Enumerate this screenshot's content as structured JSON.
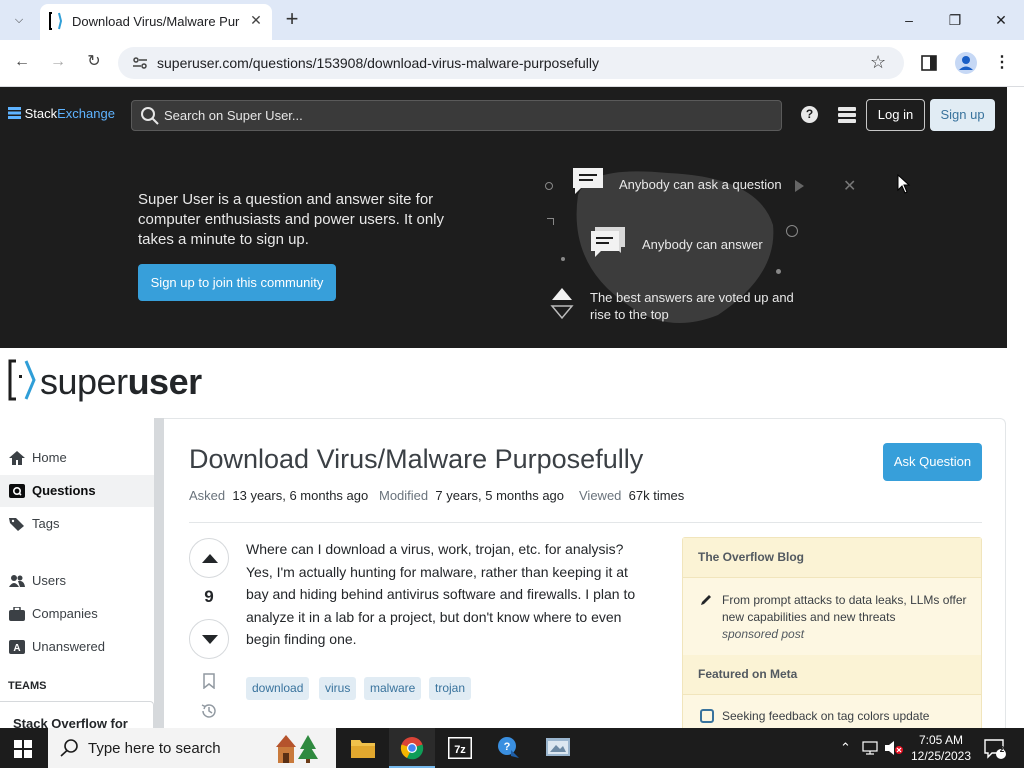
{
  "browser": {
    "tab_title": "Download Virus/Malware Purpos",
    "url": "superuser.com/questions/153908/download-virus-malware-purposefully",
    "new_tab": "+"
  },
  "topbar": {
    "logo_stack": "Stack",
    "logo_exchange": "Exchange",
    "search_placeholder": "Search on Super User...",
    "help": "?",
    "login": "Log in",
    "signup": "Sign up"
  },
  "banner": {
    "pitch": "Super User is a question and answer site for computer enthusiasts and power users. It only takes a minute to sign up.",
    "join": "Sign up to join this community",
    "feature_1": "Anybody can ask a question",
    "feature_2": "Anybody can answer",
    "feature_3": "The best answers are voted up and rise to the top"
  },
  "site": {
    "name_light": "super",
    "name_bold": "user"
  },
  "nav": {
    "items": [
      {
        "label": "Home"
      },
      {
        "label": "Questions"
      },
      {
        "label": "Tags"
      },
      {
        "label": "Users"
      },
      {
        "label": "Companies"
      },
      {
        "label": "Unanswered"
      }
    ],
    "teams_heading": "TEAMS",
    "teams_item": "Stack Overflow for"
  },
  "question": {
    "title": "Download Virus/Malware Purposefully",
    "ask_button": "Ask Question",
    "asked_label": "Asked",
    "asked_value": "13 years, 6 months ago",
    "modified_label": "Modified",
    "modified_value": "7 years, 5 months ago",
    "viewed_label": "Viewed",
    "viewed_value": "67k times",
    "score": "9",
    "body": "Where can I download a virus, work, trojan, etc. for analysis? Yes, I'm actually hunting for malware, rather than keeping it at bay and hiding behind antivirus software and firewalls. I plan to analyze it in a lab for a project, but don't know where to even begin finding one.",
    "tags": [
      "download",
      "virus",
      "malware",
      "trojan"
    ]
  },
  "sidebar": {
    "blog_heading": "The Overflow Blog",
    "blog_item": "From prompt attacks to data leaks, LLMs offer new capabilities and new threats",
    "blog_sub": "sponsored post",
    "meta_heading": "Featured on Meta",
    "meta_item": "Seeking feedback on tag colors update"
  },
  "taskbar": {
    "search_placeholder": "Type here to search",
    "time": "7:05 AM",
    "date": "12/25/2023",
    "notifications": "2"
  },
  "colors": {
    "accent": "#379fda",
    "tag_bg": "#e1ecf4",
    "tag_fg": "#39739d",
    "dark_bar": "#1d1d1d",
    "widget_bg": "#fdf7e2"
  }
}
